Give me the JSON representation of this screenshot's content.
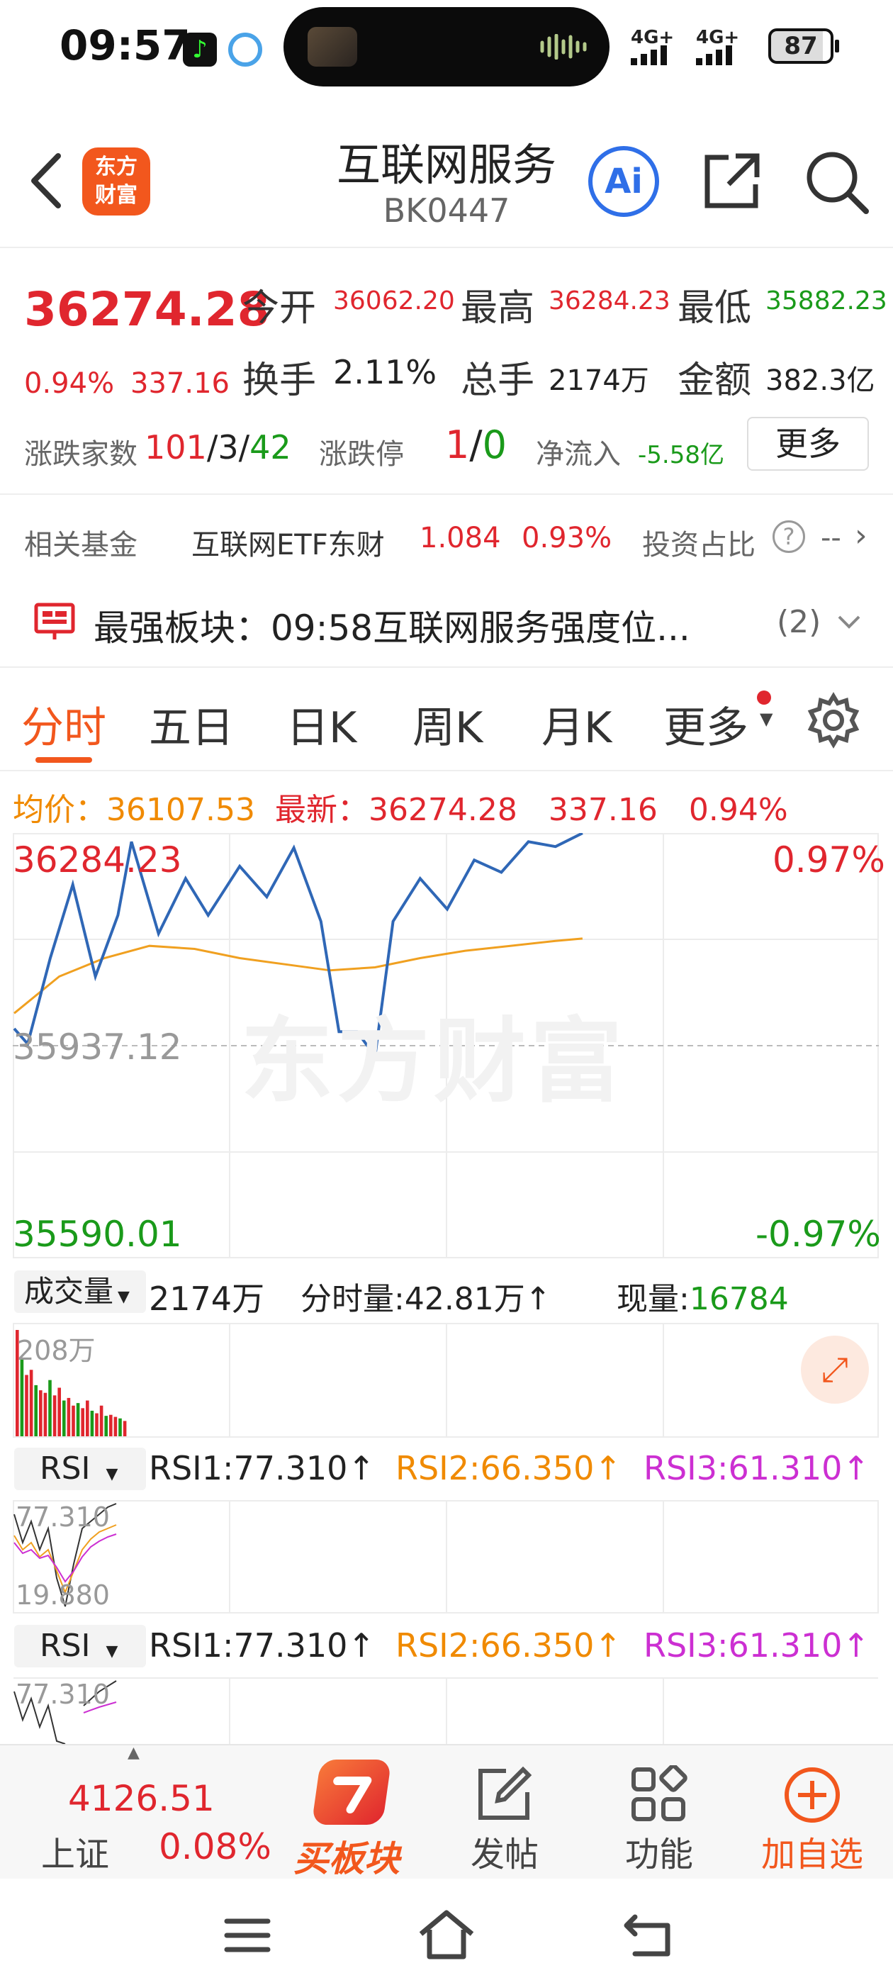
{
  "status": {
    "time": "09:57",
    "net1": "4G+",
    "net2": "4G+",
    "battery": "87"
  },
  "header": {
    "back": "back-arrow-icon",
    "logo_line1": "东方",
    "logo_line2": "财富",
    "title": "互联网服务",
    "code": "BK0447",
    "ai_label": "Ai"
  },
  "quote": {
    "price": "36274.28",
    "change_pct": "0.94%",
    "change_amt": "337.16",
    "open_label": "今开",
    "open": "36062.20",
    "high_label": "最高",
    "high": "36284.23",
    "low_label": "最低",
    "low": "35882.23",
    "turnover_label": "换手",
    "turnover": "2.11%",
    "volume_label": "总手",
    "volume": "2174万",
    "amount_label": "金额",
    "amount": "382.3亿",
    "breadth_label": "涨跌家数",
    "up": "101",
    "flat": "3",
    "down": "42",
    "limit_label": "涨跌停",
    "limit_up": "1",
    "limit_down": "0",
    "netflow_label": "净流入",
    "netflow": "-5.58亿",
    "more": "更多"
  },
  "fund": {
    "label": "相关基金",
    "name": "互联网ETF东财",
    "price": "1.084",
    "pct": "0.93%",
    "ratio_label": "投资占比",
    "ratio": "--"
  },
  "banner": {
    "text": "最强板块：09:58互联网服务强度位...",
    "count": "(2)"
  },
  "tabs": [
    "分时",
    "五日",
    "日K",
    "周K",
    "月K",
    "更多"
  ],
  "avgline": {
    "avg_label": "均价：",
    "avg": "36107.53",
    "last_label": "最新：",
    "last": "36274.28",
    "chg": "337.16",
    "pct": "0.94%"
  },
  "chart": {
    "top_price": "36284.23",
    "mid_price": "35937.12",
    "bot_price": "35590.01",
    "top_pct": "0.97%",
    "bot_pct": "-0.97%",
    "watermark": "东方财富",
    "line": [
      [
        0,
        35965
      ],
      [
        0.3,
        35940
      ],
      [
        0.8,
        36080
      ],
      [
        1.3,
        36200
      ],
      [
        1.8,
        36050
      ],
      [
        2.3,
        36150
      ],
      [
        2.6,
        36270
      ],
      [
        3.2,
        36120
      ],
      [
        3.8,
        36210
      ],
      [
        4.3,
        36150
      ],
      [
        5,
        36230
      ],
      [
        5.6,
        36180
      ],
      [
        6.2,
        36260
      ],
      [
        6.8,
        36140
      ],
      [
        7.2,
        35960
      ],
      [
        7.6,
        35960
      ],
      [
        8,
        35920
      ],
      [
        8.4,
        36140
      ],
      [
        9,
        36210
      ],
      [
        9.6,
        36160
      ],
      [
        10.2,
        36240
      ],
      [
        10.8,
        36220
      ],
      [
        11.4,
        36270
      ],
      [
        12,
        36262
      ],
      [
        12.6,
        36284
      ]
    ],
    "avg": [
      [
        0,
        35990
      ],
      [
        1,
        36050
      ],
      [
        2,
        36080
      ],
      [
        3,
        36100
      ],
      [
        4,
        36095
      ],
      [
        5,
        36080
      ],
      [
        6,
        36070
      ],
      [
        7,
        36060
      ],
      [
        8,
        36065
      ],
      [
        9,
        36080
      ],
      [
        10,
        36092
      ],
      [
        11,
        36100
      ],
      [
        12,
        36108
      ],
      [
        12.6,
        36112
      ]
    ],
    "ymin": 35590.01,
    "ymax": 36284.23,
    "xmax": 240
  },
  "volume": {
    "selector": "成交量",
    "total": "2174万",
    "tick_label": "分时量:",
    "tick": "42.81万",
    "now_label": "现量:",
    "now": "16784",
    "max": "208万",
    "bars": [
      208,
      150,
      120,
      130,
      100,
      90,
      85,
      110,
      80,
      95,
      70,
      75,
      60,
      65,
      55,
      70,
      50,
      45,
      60,
      40,
      42,
      38,
      35,
      30
    ]
  },
  "rsi1": {
    "selector": "RSI",
    "r1": "RSI1:77.310",
    "r2": "RSI2:66.350",
    "r3": "RSI3:61.310",
    "top": "77.310",
    "bot": "19.880"
  },
  "rsi2": {
    "selector": "RSI",
    "r1": "RSI1:77.310",
    "r2": "RSI2:66.350",
    "r3": "RSI3:61.310",
    "top": "77.310"
  },
  "nav": {
    "index_value": "4126.51",
    "index_name": "上证",
    "index_pct": "0.08%",
    "buy": "买板块",
    "post": "发帖",
    "func": "功能",
    "add": "加自选"
  }
}
